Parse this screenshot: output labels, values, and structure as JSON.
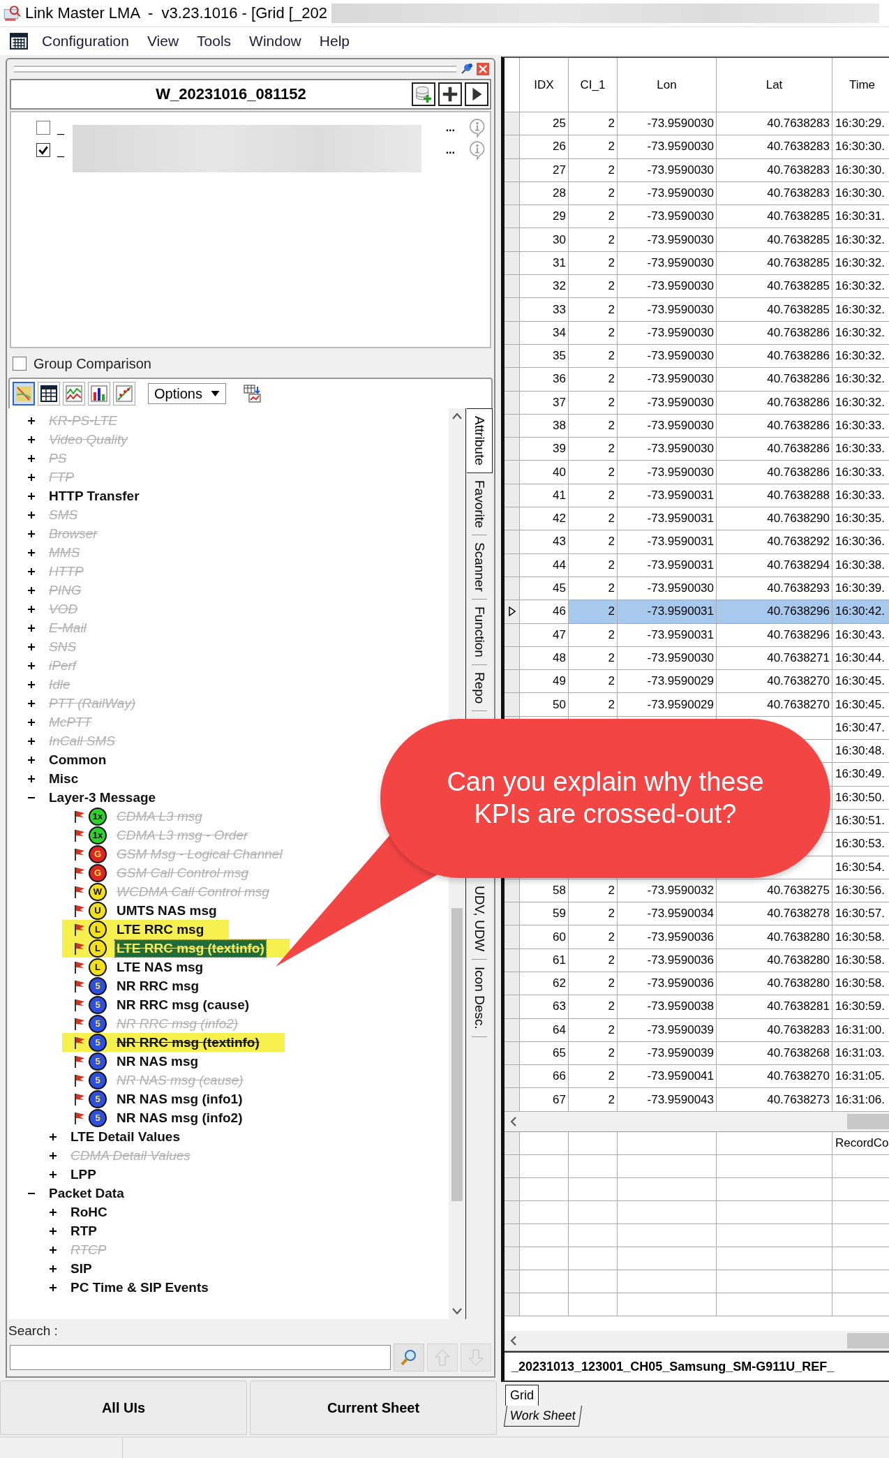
{
  "window": {
    "title": "Link Master LMA  -  v3.23.1016 - [Grid [_202"
  },
  "menu": [
    "Configuration",
    "View",
    "Tools",
    "Window",
    "Help"
  ],
  "workspace": {
    "title": "W_20231016_081152",
    "files": [
      {
        "prefix": "_",
        "suffix": "...",
        "checked": false
      },
      {
        "prefix": "_",
        "suffix": "...",
        "checked": true
      }
    ],
    "group_comparison": {
      "label": "Group Comparison",
      "checked": false
    },
    "tools": [
      {
        "kind": "map",
        "selected": true
      },
      {
        "kind": "table",
        "selected": false
      },
      {
        "kind": "line",
        "selected": false
      },
      {
        "kind": "bar",
        "selected": false
      },
      {
        "kind": "scatter",
        "selected": false
      }
    ],
    "options_label": "Options"
  },
  "tree": [
    {
      "children": [
        {
          "kind": "group",
          "label": "KR-PS-LTE",
          "expanded": false,
          "greyed": true,
          "crossed_out": true,
          "selected": false,
          "highlighted": false
        },
        {
          "kind": "group",
          "label": "Video Quality",
          "expanded": false,
          "greyed": true,
          "crossed_out": true,
          "selected": false,
          "highlighted": false
        },
        {
          "kind": "group",
          "label": "PS",
          "expanded": false,
          "greyed": true,
          "crossed_out": true,
          "selected": false,
          "highlighted": false
        },
        {
          "kind": "group",
          "label": "FTP",
          "expanded": false,
          "greyed": true,
          "crossed_out": true,
          "selected": false,
          "highlighted": false
        },
        {
          "kind": "group",
          "label": "HTTP Transfer",
          "expanded": false,
          "greyed": false,
          "crossed_out": false,
          "selected": false,
          "highlighted": false
        },
        {
          "kind": "group",
          "label": "SMS",
          "expanded": false,
          "greyed": true,
          "crossed_out": true,
          "selected": false,
          "highlighted": false
        },
        {
          "kind": "group",
          "label": "Browser",
          "expanded": false,
          "greyed": true,
          "crossed_out": true,
          "selected": false,
          "highlighted": false
        },
        {
          "kind": "group",
          "label": "MMS",
          "expanded": false,
          "greyed": true,
          "crossed_out": true,
          "selected": false,
          "highlighted": false
        },
        {
          "kind": "group",
          "label": "HTTP",
          "expanded": false,
          "greyed": true,
          "crossed_out": true,
          "selected": false,
          "highlighted": false
        },
        {
          "kind": "group",
          "label": "PING",
          "expanded": false,
          "greyed": true,
          "crossed_out": true,
          "selected": false,
          "highlighted": false
        },
        {
          "kind": "group",
          "label": "VOD",
          "expanded": false,
          "greyed": true,
          "crossed_out": true,
          "selected": false,
          "highlighted": false
        },
        {
          "kind": "group",
          "label": "E-Mail",
          "expanded": false,
          "greyed": true,
          "crossed_out": true,
          "selected": false,
          "highlighted": false
        },
        {
          "kind": "group",
          "label": "SNS",
          "expanded": false,
          "greyed": true,
          "crossed_out": true,
          "selected": false,
          "highlighted": false
        },
        {
          "kind": "group",
          "label": "iPerf",
          "expanded": false,
          "greyed": true,
          "crossed_out": true,
          "selected": false,
          "highlighted": false
        },
        {
          "kind": "group",
          "label": "Idle",
          "expanded": false,
          "greyed": true,
          "crossed_out": true,
          "selected": false,
          "highlighted": false
        },
        {
          "kind": "group",
          "label": "PTT (RailWay)",
          "expanded": false,
          "greyed": true,
          "crossed_out": true,
          "selected": false,
          "highlighted": false
        },
        {
          "kind": "group",
          "label": "McPTT",
          "expanded": false,
          "greyed": true,
          "crossed_out": true,
          "selected": false,
          "highlighted": false
        },
        {
          "kind": "group",
          "label": "InCall SMS",
          "expanded": false,
          "greyed": true,
          "crossed_out": true,
          "selected": false,
          "highlighted": false
        },
        {
          "kind": "group",
          "label": "Common",
          "expanded": false,
          "greyed": false,
          "crossed_out": false,
          "selected": false,
          "highlighted": false
        },
        {
          "kind": "group",
          "label": "Misc",
          "expanded": false,
          "greyed": false,
          "crossed_out": false,
          "selected": false,
          "highlighted": false
        }
      ]
    },
    {
      "kind": "group",
      "label": "Layer-3 Message",
      "expanded": true,
      "greyed": false,
      "crossed_out": false,
      "selected": false,
      "highlighted": false,
      "children": [
        {
          "kind": "msg",
          "label": "CDMA L3 msg",
          "badge": "1x",
          "color": "#2ed12e",
          "greyed": true,
          "crossed_out": true,
          "selected": false,
          "highlighted": false
        },
        {
          "kind": "msg",
          "label": "CDMA L3 msg - Order",
          "badge": "1x",
          "color": "#2ed12e",
          "greyed": true,
          "crossed_out": true,
          "selected": false,
          "highlighted": false
        },
        {
          "kind": "msg",
          "label": "GSM Msg - Logical Channel",
          "badge": "G",
          "color": "#e02424",
          "greyed": true,
          "crossed_out": true,
          "selected": false,
          "highlighted": false
        },
        {
          "kind": "msg",
          "label": "GSM Call Control msg",
          "badge": "G",
          "color": "#e02424",
          "greyed": true,
          "crossed_out": true,
          "selected": false,
          "highlighted": false
        },
        {
          "kind": "msg",
          "label": "WCDMA Call Control msg",
          "badge": "W",
          "color": "#f2e01c",
          "greyed": true,
          "crossed_out": true,
          "selected": false,
          "highlighted": false
        },
        {
          "kind": "msg",
          "label": "UMTS NAS msg",
          "badge": "U",
          "color": "#f2e01c",
          "greyed": false,
          "crossed_out": false,
          "selected": false,
          "highlighted": false
        },
        {
          "kind": "msg",
          "label": "LTE RRC msg",
          "badge": "L",
          "color": "#f2e01c",
          "greyed": false,
          "crossed_out": false,
          "selected": false,
          "highlighted": true
        },
        {
          "kind": "msg",
          "label": "LTE RRC msg (textinfo)",
          "badge": "L",
          "color": "#f2e01c",
          "greyed": false,
          "crossed_out": true,
          "selected": true,
          "highlighted": true
        },
        {
          "kind": "msg",
          "label": "LTE NAS msg",
          "badge": "L",
          "color": "#f2e01c",
          "greyed": false,
          "crossed_out": false,
          "selected": false,
          "highlighted": false
        },
        {
          "kind": "msg",
          "label": "NR RRC msg",
          "badge": "5",
          "color": "#2f4fe0",
          "greyed": false,
          "crossed_out": false,
          "selected": false,
          "highlighted": false
        },
        {
          "kind": "msg",
          "label": "NR RRC msg (cause)",
          "badge": "5",
          "color": "#2f4fe0",
          "greyed": false,
          "crossed_out": false,
          "selected": false,
          "highlighted": false
        },
        {
          "kind": "msg",
          "label": "NR RRC msg (info2)",
          "badge": "5",
          "color": "#2f4fe0",
          "greyed": true,
          "crossed_out": true,
          "selected": false,
          "highlighted": false
        },
        {
          "kind": "msg",
          "label": "NR RRC msg (textinfo)",
          "badge": "5",
          "color": "#2f4fe0",
          "greyed": false,
          "crossed_out": true,
          "selected": false,
          "highlighted": true
        },
        {
          "kind": "msg",
          "label": "NR NAS msg",
          "badge": "5",
          "color": "#2f4fe0",
          "greyed": false,
          "crossed_out": false,
          "selected": false,
          "highlighted": false
        },
        {
          "kind": "msg",
          "label": "NR NAS msg (cause)",
          "badge": "5",
          "color": "#2f4fe0",
          "greyed": true,
          "crossed_out": true,
          "selected": false,
          "highlighted": false
        },
        {
          "kind": "msg",
          "label": "NR NAS msg (info1)",
          "badge": "5",
          "color": "#2f4fe0",
          "greyed": false,
          "crossed_out": false,
          "selected": false,
          "highlighted": false
        },
        {
          "kind": "msg",
          "label": "NR NAS msg (info2)",
          "badge": "5",
          "color": "#2f4fe0",
          "greyed": false,
          "crossed_out": false,
          "selected": false,
          "highlighted": false
        },
        {
          "kind": "group",
          "label": "LTE Detail Values",
          "expanded": false,
          "greyed": false,
          "crossed_out": false,
          "selected": false,
          "highlighted": false
        },
        {
          "kind": "group",
          "label": "CDMA Detail Values",
          "expanded": false,
          "greyed": true,
          "crossed_out": true,
          "selected": false,
          "highlighted": false
        },
        {
          "kind": "group",
          "label": "LPP",
          "expanded": false,
          "greyed": false,
          "crossed_out": false,
          "selected": false,
          "highlighted": false
        }
      ]
    },
    {
      "kind": "group",
      "label": "Packet Data",
      "expanded": true,
      "greyed": false,
      "crossed_out": false,
      "selected": false,
      "highlighted": false,
      "children": [
        {
          "kind": "group",
          "label": "RoHC",
          "expanded": false,
          "greyed": false,
          "crossed_out": false,
          "selected": false,
          "highlighted": false
        },
        {
          "kind": "group",
          "label": "RTP",
          "expanded": false,
          "greyed": false,
          "crossed_out": false,
          "selected": false,
          "highlighted": false
        },
        {
          "kind": "group",
          "label": "RTCP",
          "expanded": false,
          "greyed": true,
          "crossed_out": true,
          "selected": false,
          "highlighted": false
        },
        {
          "kind": "group",
          "label": "SIP",
          "expanded": false,
          "greyed": false,
          "crossed_out": false,
          "selected": false,
          "highlighted": false
        },
        {
          "kind": "group",
          "label": "PC Time & SIP Events",
          "expanded": false,
          "greyed": false,
          "crossed_out": false,
          "selected": false,
          "highlighted": false
        }
      ]
    }
  ],
  "side_tabs": [
    {
      "label": "Attribute",
      "selected": true
    },
    {
      "label": "Favorite",
      "selected": false
    },
    {
      "label": "Scanner",
      "selected": false
    },
    {
      "label": "Function",
      "selected": false
    },
    {
      "label": "Repo",
      "selected": false
    }
  ],
  "side_tabs_lower": [
    {
      "label": "UDV, UDW",
      "selected": false
    },
    {
      "label": "Icon Desc.",
      "selected": false
    }
  ],
  "search": {
    "label": "Search :",
    "buttons": [
      {
        "kind": "search",
        "disabled": false
      },
      {
        "kind": "up",
        "disabled": true
      },
      {
        "kind": "down",
        "disabled": true
      }
    ]
  },
  "bottom_buttons": [
    "All UIs",
    "Current Sheet"
  ],
  "grid": {
    "columns": [
      "IDX",
      "CI_1",
      "Lon",
      "Lat",
      "Time"
    ],
    "rows": [
      {
        "cells": [
          "25",
          "2",
          "-73.9590030",
          "40.7638283",
          "16:30:29."
        ],
        "selected": false
      },
      {
        "cells": [
          "26",
          "2",
          "-73.9590030",
          "40.7638283",
          "16:30:30."
        ],
        "selected": false
      },
      {
        "cells": [
          "27",
          "2",
          "-73.9590030",
          "40.7638283",
          "16:30:30."
        ],
        "selected": false
      },
      {
        "cells": [
          "28",
          "2",
          "-73.9590030",
          "40.7638283",
          "16:30:30."
        ],
        "selected": false
      },
      {
        "cells": [
          "29",
          "2",
          "-73.9590030",
          "40.7638285",
          "16:30:31."
        ],
        "selected": false
      },
      {
        "cells": [
          "30",
          "2",
          "-73.9590030",
          "40.7638285",
          "16:30:32."
        ],
        "selected": false
      },
      {
        "cells": [
          "31",
          "2",
          "-73.9590030",
          "40.7638285",
          "16:30:32."
        ],
        "selected": false
      },
      {
        "cells": [
          "32",
          "2",
          "-73.9590030",
          "40.7638285",
          "16:30:32."
        ],
        "selected": false
      },
      {
        "cells": [
          "33",
          "2",
          "-73.9590030",
          "40.7638285",
          "16:30:32."
        ],
        "selected": false
      },
      {
        "cells": [
          "34",
          "2",
          "-73.9590030",
          "40.7638286",
          "16:30:32."
        ],
        "selected": false
      },
      {
        "cells": [
          "35",
          "2",
          "-73.9590030",
          "40.7638286",
          "16:30:32."
        ],
        "selected": false
      },
      {
        "cells": [
          "36",
          "2",
          "-73.9590030",
          "40.7638286",
          "16:30:32."
        ],
        "selected": false
      },
      {
        "cells": [
          "37",
          "2",
          "-73.9590030",
          "40.7638286",
          "16:30:32."
        ],
        "selected": false
      },
      {
        "cells": [
          "38",
          "2",
          "-73.9590030",
          "40.7638286",
          "16:30:33."
        ],
        "selected": false
      },
      {
        "cells": [
          "39",
          "2",
          "-73.9590030",
          "40.7638286",
          "16:30:33."
        ],
        "selected": false
      },
      {
        "cells": [
          "40",
          "2",
          "-73.9590030",
          "40.7638286",
          "16:30:33."
        ],
        "selected": false
      },
      {
        "cells": [
          "41",
          "2",
          "-73.9590031",
          "40.7638288",
          "16:30:33."
        ],
        "selected": false
      },
      {
        "cells": [
          "42",
          "2",
          "-73.9590031",
          "40.7638290",
          "16:30:35."
        ],
        "selected": false
      },
      {
        "cells": [
          "43",
          "2",
          "-73.9590031",
          "40.7638292",
          "16:30:36."
        ],
        "selected": false
      },
      {
        "cells": [
          "44",
          "2",
          "-73.9590031",
          "40.7638294",
          "16:30:38."
        ],
        "selected": false
      },
      {
        "cells": [
          "45",
          "2",
          "-73.9590030",
          "40.7638293",
          "16:30:39."
        ],
        "selected": false
      },
      {
        "cells": [
          "46",
          "2",
          "-73.9590031",
          "40.7638296",
          "16:30:42."
        ],
        "selected": true
      },
      {
        "cells": [
          "47",
          "2",
          "-73.9590031",
          "40.7638296",
          "16:30:43."
        ],
        "selected": false
      },
      {
        "cells": [
          "48",
          "2",
          "-73.9590030",
          "40.7638271",
          "16:30:44."
        ],
        "selected": false
      },
      {
        "cells": [
          "49",
          "2",
          "-73.9590029",
          "40.7638270",
          "16:30:45."
        ],
        "selected": false
      },
      {
        "cells": [
          "50",
          "2",
          "-73.9590029",
          "40.7638270",
          "16:30:45."
        ],
        "selected": false
      },
      {
        "cells": [
          null,
          null,
          null,
          null,
          "16:30:47."
        ]
      },
      {
        "cells": [
          null,
          null,
          null,
          null,
          "16:30:48."
        ]
      },
      {
        "cells": [
          null,
          null,
          null,
          null,
          "16:30:49."
        ]
      },
      {
        "cells": [
          null,
          null,
          null,
          null,
          "16:30:50."
        ]
      },
      {
        "cells": [
          null,
          null,
          null,
          null,
          "16:30:51."
        ]
      },
      {
        "cells": [
          null,
          null,
          null,
          null,
          "16:30:53."
        ]
      },
      {
        "cells": [
          null,
          null,
          null,
          null,
          "16:30:54."
        ]
      },
      {
        "cells": [
          "58",
          "2",
          "-73.9590032",
          "40.7638275",
          "16:30:56."
        ],
        "selected": false
      },
      {
        "cells": [
          "59",
          "2",
          "-73.9590034",
          "40.7638278",
          "16:30:57."
        ],
        "selected": false
      },
      {
        "cells": [
          "60",
          "2",
          "-73.9590036",
          "40.7638280",
          "16:30:58."
        ],
        "selected": false
      },
      {
        "cells": [
          "61",
          "2",
          "-73.9590036",
          "40.7638280",
          "16:30:58."
        ],
        "selected": false
      },
      {
        "cells": [
          "62",
          "2",
          "-73.9590036",
          "40.7638280",
          "16:30:58."
        ],
        "selected": false
      },
      {
        "cells": [
          "63",
          "2",
          "-73.9590038",
          "40.7638281",
          "16:30:59."
        ],
        "selected": false
      },
      {
        "cells": [
          "64",
          "2",
          "-73.9590039",
          "40.7638283",
          "16:31:00."
        ],
        "selected": false
      },
      {
        "cells": [
          "65",
          "2",
          "-73.9590039",
          "40.7638268",
          "16:31:03."
        ],
        "selected": false
      },
      {
        "cells": [
          "66",
          "2",
          "-73.9590041",
          "40.7638270",
          "16:31:05."
        ],
        "selected": false
      },
      {
        "cells": [
          "67",
          "2",
          "-73.9590043",
          "40.7638273",
          "16:31:06."
        ],
        "selected": false
      }
    ]
  },
  "summary_grid": {
    "column_5": "RecordCo"
  },
  "file_name": "_20231013_123001_CH05_Samsung_SM-G911U_REF_",
  "sheet_tabs": [
    {
      "label": "Grid",
      "selected": true
    },
    {
      "label": "Work Sheet",
      "selected": false
    }
  ],
  "callout": {
    "text": "Can you explain why these KPIs are crossed-out?"
  }
}
